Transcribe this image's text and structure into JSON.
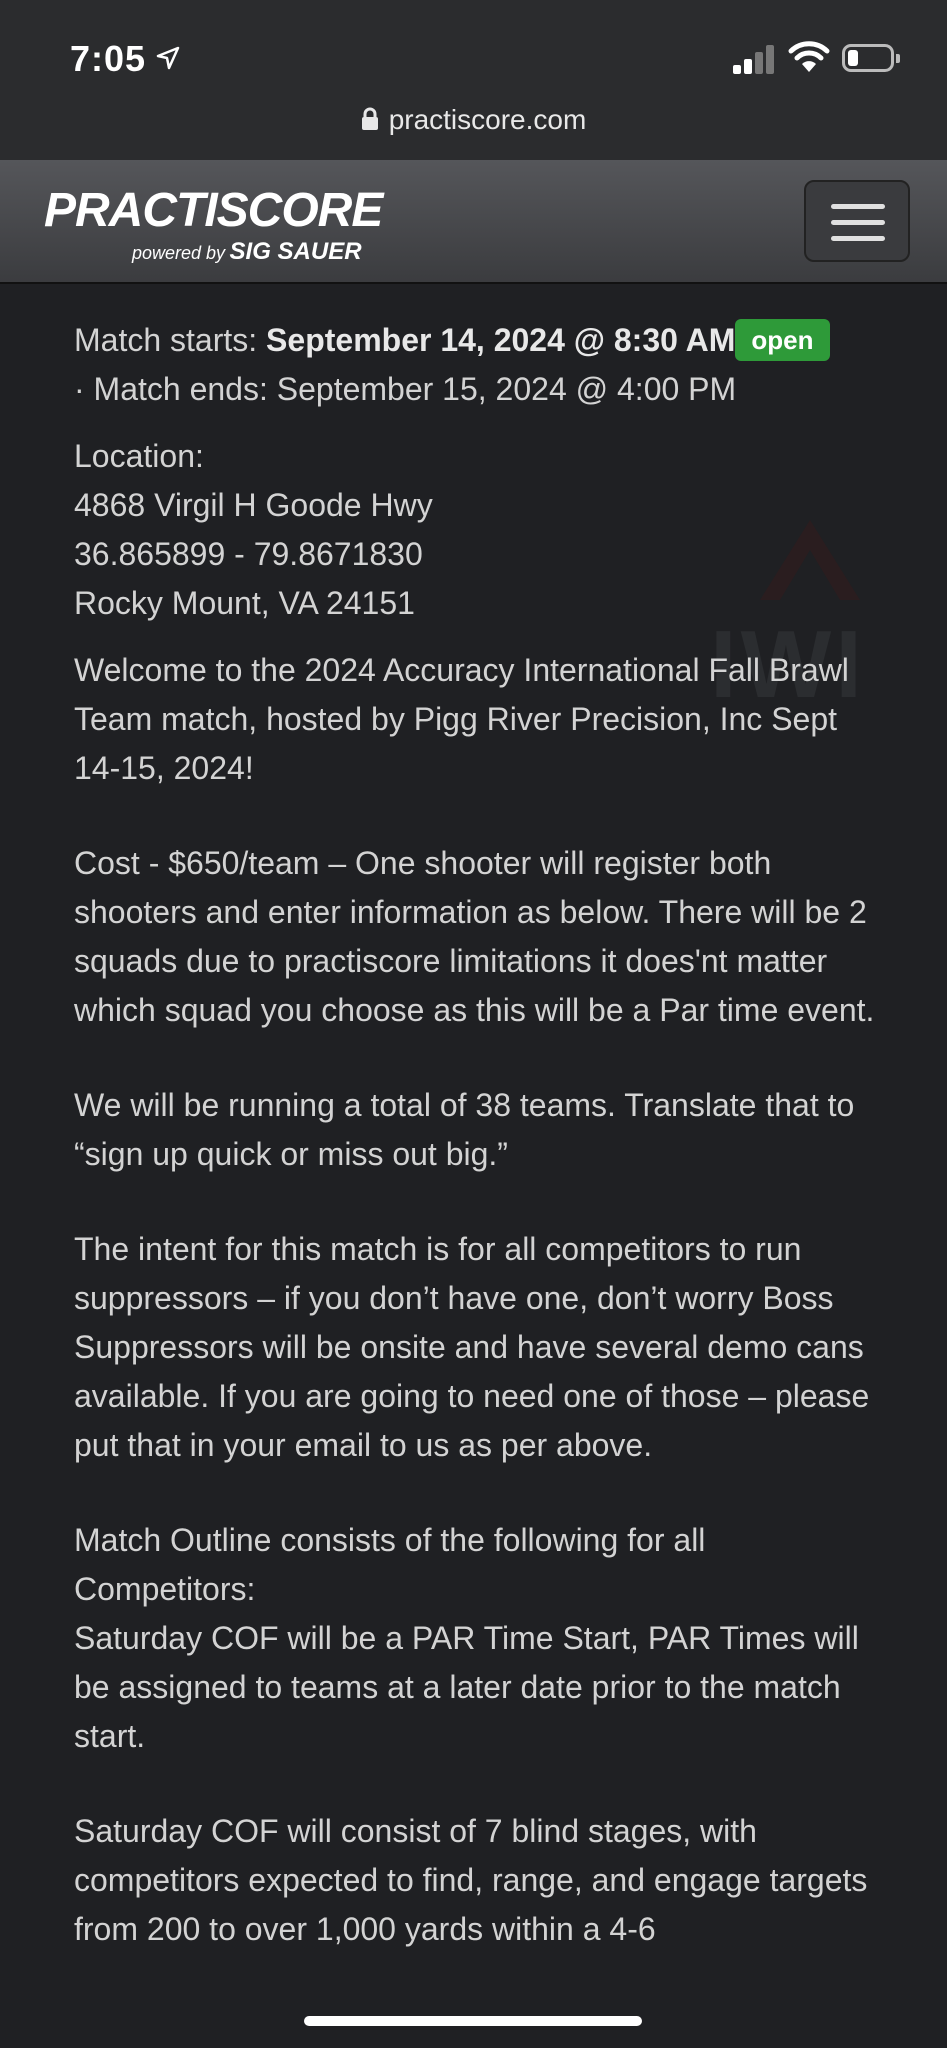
{
  "status_bar": {
    "time": "7:05",
    "battery_level": 0.25
  },
  "browser": {
    "url": "practiscore.com"
  },
  "brand": {
    "logo_main": "PRACTISCORE",
    "logo_powered": "powered by",
    "logo_partner": "SIG SAUER",
    "watermark": "IWI"
  },
  "match": {
    "starts_label": "Match starts:",
    "starts_value": "September 14, 2024 @ 8:30 AM",
    "status_badge": "open",
    "ends_text": "· Match ends: September 15, 2024 @ 4:00 PM"
  },
  "location": {
    "label": "Location:",
    "address": "4868 Virgil H Goode Hwy",
    "coords": "36.865899 - 79.8671830",
    "city": "Rocky Mount, VA 24151"
  },
  "description": {
    "p1": "Welcome to the 2024 Accuracy International Fall Brawl Team match, hosted by Pigg River Precision, Inc Sept 14-15, 2024!",
    "p2": "Cost - $650/team – One shooter will register both shooters and enter information as below. There will be 2 squads due to practiscore limitations it does'nt matter which squad you choose as this will be a Par time event.",
    "p3": "We will be running a total of 38 teams. Translate that to “sign up quick or miss out big.”",
    "p4": "The intent for this match is for all competitors to run suppressors – if you don’t have one, don’t worry Boss Suppressors will be onsite and have several demo cans available. If you are going to need one of those – please put that in your email to us as per above.",
    "p5a": "Match Outline consists of the following for all Competitors:",
    "p5b": "Saturday COF will be a PAR Time Start, PAR Times will be assigned to teams at a later date prior to the match start.",
    "p6": "Saturday COF will consist of 7 blind stages, with competitors expected to find, range, and engage targets from 200 to over 1,000 yards within a 4-6"
  },
  "colors": {
    "background": "#1f2023",
    "badge": "#2e9a39",
    "navbar": "#48494c"
  }
}
